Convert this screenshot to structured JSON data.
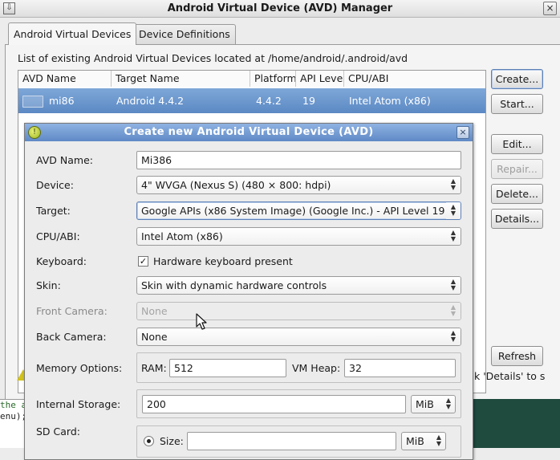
{
  "window": {
    "title": "Android Virtual Device (AVD) Manager",
    "menu_glyph": "⇩",
    "close_glyph": "×"
  },
  "tabs": [
    {
      "label": "Android Virtual Devices",
      "active": true
    },
    {
      "label": "Device Definitions",
      "active": false
    }
  ],
  "list_label": "List of existing Android Virtual Devices located at /home/android/.android/avd",
  "table": {
    "columns": [
      "AVD Name",
      "Target Name",
      "Platform",
      "API Leve",
      "CPU/ABI"
    ],
    "rows": [
      {
        "avd_name": "mi86",
        "target_name": "Android 4.4.2",
        "platform": "4.4.2",
        "api_level": "19",
        "cpu_abi": "Intel Atom (x86)",
        "selected": true
      }
    ]
  },
  "side_buttons": {
    "create": "Create...",
    "start": "Start...",
    "edit": "Edit...",
    "repair": "Repair...",
    "delete": "Delete...",
    "details": "Details...",
    "refresh": "Refresh"
  },
  "status_text": "k 'Details' to s",
  "terminal_lines": [
    "the a",
    "enu);"
  ],
  "dialog": {
    "title": "Create new Android Virtual Device (AVD)",
    "close_glyph": "×",
    "app_icon_glyph": "!",
    "fields": {
      "avd_name": {
        "label": "AVD Name:",
        "value": "Mi386"
      },
      "device": {
        "label": "Device:",
        "value": "4\" WVGA (Nexus S) (480 × 800: hdpi)"
      },
      "target": {
        "label": "Target:",
        "value": "Google APIs (x86 System Image) (Google Inc.) - API Level 19"
      },
      "cpu_abi": {
        "label": "CPU/ABI:",
        "value": "Intel Atom (x86)"
      },
      "keyboard": {
        "label": "Keyboard:",
        "checkbox_label": "Hardware keyboard present",
        "checked": true,
        "check_glyph": "✓"
      },
      "skin": {
        "label": "Skin:",
        "value": "Skin with dynamic hardware controls"
      },
      "front_camera": {
        "label": "Front Camera:",
        "value": "None",
        "disabled": true
      },
      "back_camera": {
        "label": "Back Camera:",
        "value": "None"
      },
      "memory": {
        "label": "Memory Options:",
        "ram_label": "RAM:",
        "ram_value": "512",
        "vm_heap_label": "VM Heap:",
        "vm_heap_value": "32"
      },
      "internal_storage": {
        "label": "Internal Storage:",
        "value": "200",
        "unit": "MiB"
      },
      "sd_card": {
        "label": "SD Card:",
        "size_label": "Size:",
        "size_value": "",
        "unit": "MiB",
        "size_selected": true
      }
    },
    "combo_arrows": "▲\n▼"
  }
}
